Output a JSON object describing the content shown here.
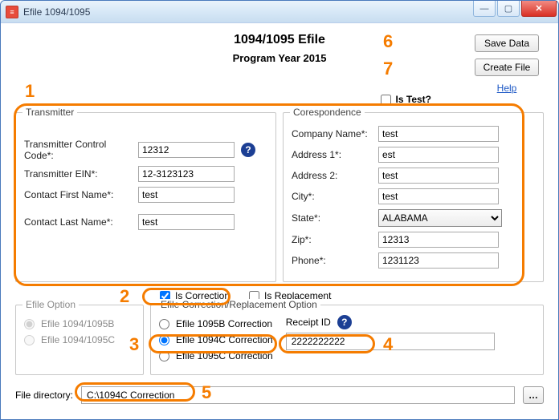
{
  "window": {
    "title": "Efile 1094/1095"
  },
  "header": {
    "title": "1094/1095 Efile",
    "subtitle": "Program Year 2015",
    "save_label": "Save Data",
    "create_label": "Create File",
    "help_label": "Help",
    "is_test_label": "Is Test?",
    "is_test_checked": false
  },
  "transmitter": {
    "legend": "Transmitter",
    "tcc_label": "Transmitter Control Code*:",
    "tcc_value": "12312",
    "ein_label": "Transmitter EIN*:",
    "ein_value": "12-3123123",
    "first_label": "Contact First Name*:",
    "first_value": "test",
    "last_label": "Contact Last Name*:",
    "last_value": "test"
  },
  "correspondence": {
    "legend": "Corespondence",
    "company_label": "Company Name*:",
    "company_value": "test",
    "addr1_label": "Address 1*:",
    "addr1_value": "est",
    "addr2_label": "Address 2:",
    "addr2_value": "test",
    "city_label": "City*:",
    "city_value": "test",
    "state_label": "State*:",
    "state_value": "ALABAMA",
    "zip_label": "Zip*:",
    "zip_value": "12313",
    "phone_label": "Phone*:",
    "phone_value": "1231123"
  },
  "flags": {
    "is_correction_label": "Is Correction",
    "is_correction_checked": true,
    "is_replacement_label": "Is Replacement",
    "is_replacement_checked": false
  },
  "efile_option": {
    "legend": "Efile Option",
    "b_label": "Efile 1094/1095B",
    "b_selected": true,
    "c_label": "Efile 1094/1095C",
    "c_selected": false
  },
  "correction_option": {
    "legend": "Efile Correction/Replacement Option",
    "opt_1095b_label": "Efile 1095B Correction",
    "opt_1094c_label": "Efile 1094C Correction",
    "opt_1095c_label": "Efile 1095C Correction",
    "selected": "1094c",
    "receipt_label": "Receipt ID",
    "receipt_value": "2222222222"
  },
  "file_dir": {
    "label": "File directory:",
    "value": "C:\\1094C Correction"
  },
  "callouts": {
    "n1": "1",
    "n2": "2",
    "n3": "3",
    "n4": "4",
    "n5": "5",
    "n6": "6",
    "n7": "7"
  }
}
